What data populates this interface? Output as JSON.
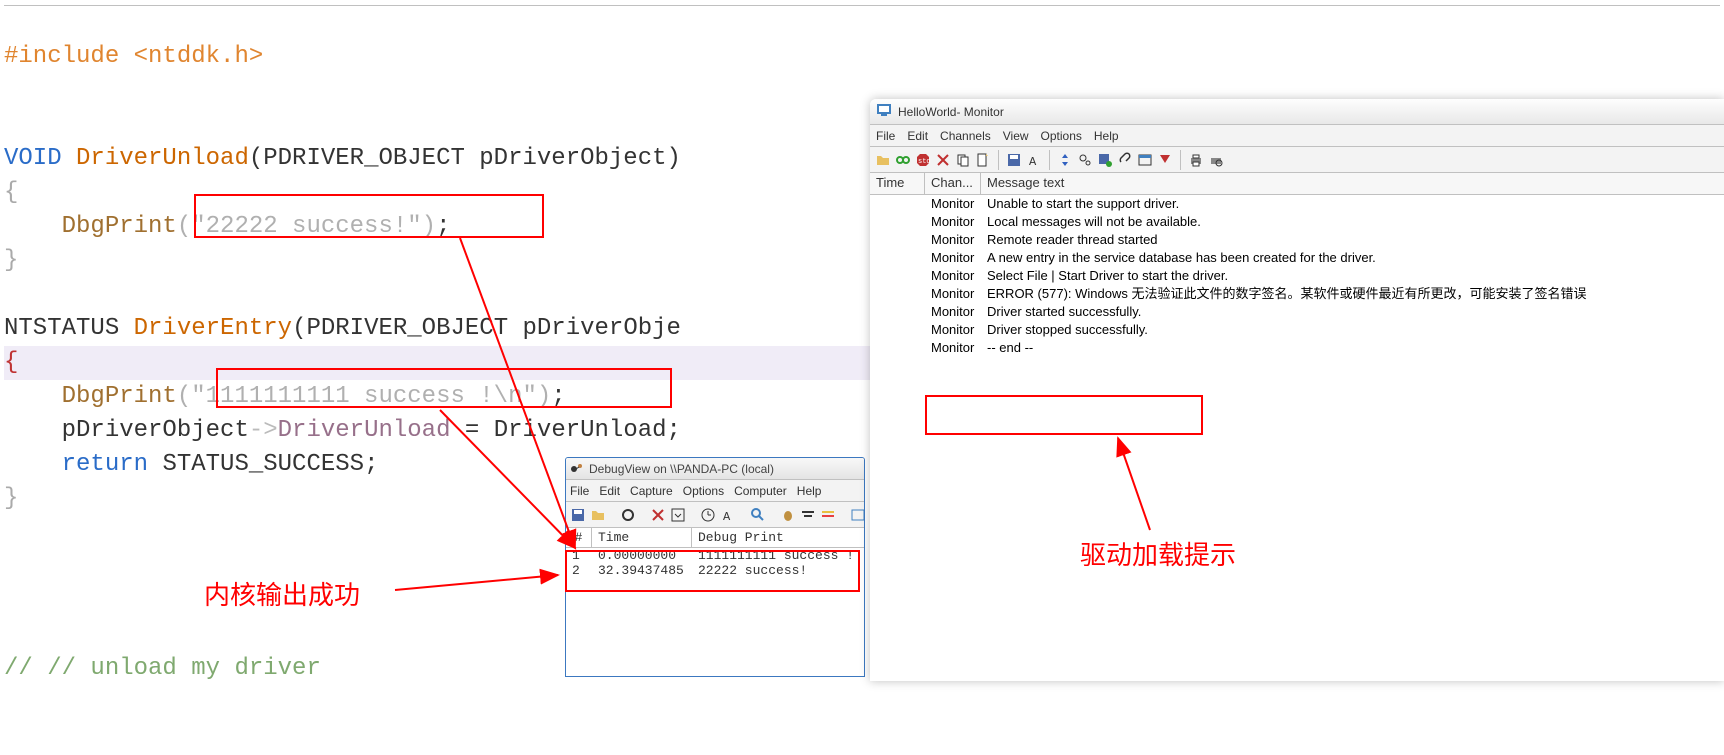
{
  "code": {
    "include_directive": "#include",
    "include_file": "<ntddk.h>",
    "line_void": "VOID",
    "line_unload_name": "DriverUnload",
    "line_unload_params": "(PDRIVER_OBJECT pDriverObject)",
    "dbgprint_fn": "DbgPrint",
    "dbgprint1_str": "(\"22222 success!\")",
    "dbgprint1_semi": ";",
    "ntstatus": "NTSTATUS",
    "entry_name": "DriverEntry",
    "entry_params": "(PDRIVER_OBJECT pDriverObje",
    "dbgprint2_str": "(\"1111111111 success !\\n\")",
    "dbgprint2_semi": ";",
    "member_line_pre": "pDriverObject",
    "member_arrow": "->",
    "member_name": "DriverUnload",
    "member_eq": "=",
    "member_rhs": "DriverUnload;",
    "return_kw": "return",
    "return_val": "STATUS_SUCCESS;",
    "comment": "// // unload my driver"
  },
  "debugview": {
    "title": "DebugView on \\\\PANDA-PC (local)",
    "menu": [
      "File",
      "Edit",
      "Capture",
      "Options",
      "Computer",
      "Help"
    ],
    "columns": {
      "id": "#",
      "time": "Time",
      "msg": "Debug Print"
    },
    "rows": [
      {
        "n": "1",
        "time": "0.00000000",
        "msg": "1111111111 success !"
      },
      {
        "n": "2",
        "time": "32.39437485",
        "msg": "22222 success!"
      }
    ]
  },
  "monitor": {
    "title": "HelloWorld- Monitor",
    "menu": [
      "File",
      "Edit",
      "Channels",
      "View",
      "Options",
      "Help"
    ],
    "columns": {
      "time": "Time",
      "chan": "Chan...",
      "msg": "Message text"
    },
    "rows": [
      {
        "chan": "Monitor",
        "msg": "Unable to start the support driver."
      },
      {
        "chan": "Monitor",
        "msg": "Local messages will not be available."
      },
      {
        "chan": "Monitor",
        "msg": "Remote reader thread started"
      },
      {
        "chan": "Monitor",
        "msg": "A new entry in the service database has been created for the driver."
      },
      {
        "chan": "Monitor",
        "msg": "Select File | Start Driver to start the driver."
      },
      {
        "chan": "Monitor",
        "msg": "ERROR (577): Windows 无法验证此文件的数字签名。某软件或硬件最近有所更改，可能安装了签名错误"
      },
      {
        "chan": "Monitor",
        "msg": "Driver started successfully."
      },
      {
        "chan": "Monitor",
        "msg": "Driver stopped successfully."
      },
      {
        "chan": "Monitor",
        "msg": "-- end --"
      }
    ]
  },
  "labels": {
    "left": "内核输出成功",
    "right": "驱动加载提示"
  }
}
